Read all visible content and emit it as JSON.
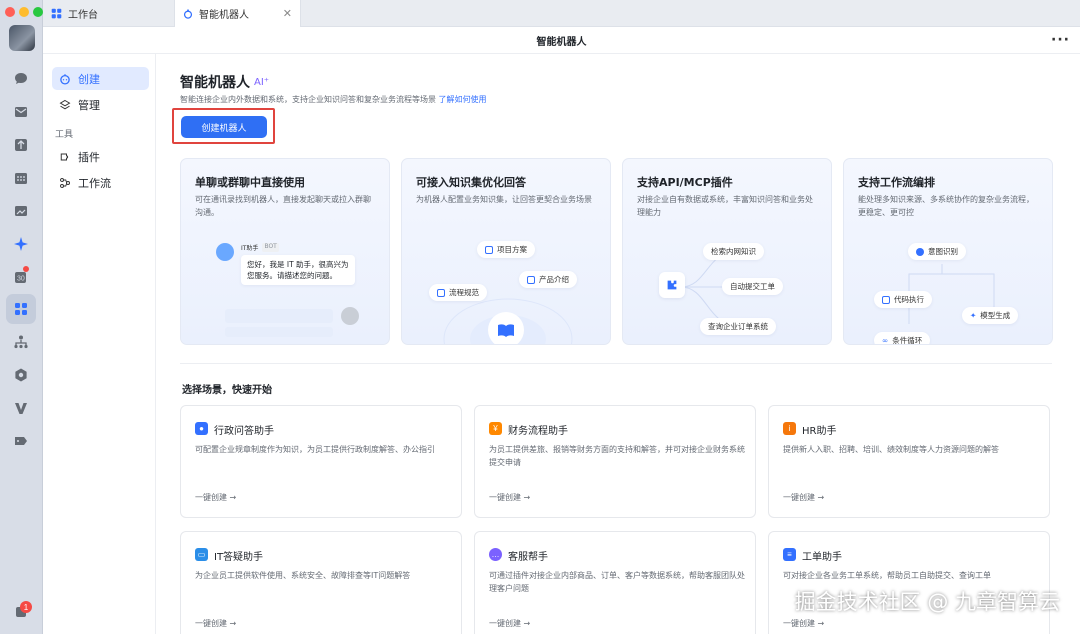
{
  "tabs": [
    {
      "label": "工作台"
    },
    {
      "label": "智能机器人"
    }
  ],
  "window_title": "智能机器人",
  "more_label": "···",
  "sidenav": {
    "create": "创建",
    "manage": "管理",
    "tools_section": "工具",
    "plugins": "插件",
    "workflow": "工作流"
  },
  "header": {
    "title": "智能机器人",
    "ai_tag": "AI⁺",
    "subtitle": "智能连接企业内外数据和系统，支持企业知识问答和复杂业务流程等场景",
    "learn_link": "了解如何使用",
    "create_button": "创建机器人"
  },
  "features": [
    {
      "title": "单聊或群聊中直接使用",
      "desc": "可在通讯录找到机器人，直接发起聊天或拉入群聊沟通。",
      "bot_name": "IT助手",
      "bot_tag": "BOT",
      "bot_message": "您好，我是 IT 助手，很高兴为您服务。请描述您的问题。"
    },
    {
      "title": "可接入知识集优化回答",
      "desc": "为机器人配置业务知识集，让回答更契合业务场景",
      "pills": [
        "项目方案",
        "产品介绍",
        "流程规范"
      ]
    },
    {
      "title": "支持API/MCP插件",
      "desc": "对接企业自有数据或系统，丰富知识问答和业务处理能力",
      "pills": [
        "检索内网知识",
        "自动提交工单",
        "查询企业订单系统"
      ]
    },
    {
      "title": "支持工作流编排",
      "desc": "能处理多知识来源、多系统协作的复杂业务流程，更稳定、更可控",
      "pills": [
        "意图识别",
        "代码执行",
        "模型生成",
        "条件循环"
      ]
    }
  ],
  "quickstart_title": "选择场景，快速开始",
  "cards": [
    {
      "title": "行政问答助手",
      "desc": "可配置企业规章制度作为知识，为员工提供行政制度解答、办公指引",
      "link": "一键创建 →",
      "color": "#3370ff",
      "icon": "person-icon"
    },
    {
      "title": "财务流程助手",
      "desc": "为员工提供差旅、报销等财务方面的支持和解答，并可对接企业财务系统提交申请",
      "link": "一键创建 →",
      "color": "#ff8800",
      "icon": "yen-icon"
    },
    {
      "title": "HR助手",
      "desc": "提供新人入职、招聘、培训、绩效制度等人力资源问题的解答",
      "link": "一键创建 →",
      "color": "#f5770b",
      "icon": "info-icon"
    },
    {
      "title": "IT答疑助手",
      "desc": "为企业员工提供软件使用、系统安全、故障排查等IT问题解答",
      "link": "一键创建 →",
      "color": "#2b8ee8",
      "icon": "monitor-icon"
    },
    {
      "title": "客服帮手",
      "desc": "可通过插件对接企业内部商品、订单、客户等数据系统，帮助客服团队处理客户问题",
      "link": "一键创建 →",
      "color": "#7b61ff",
      "icon": "chat-icon"
    },
    {
      "title": "工单助手",
      "desc": "可对接企业各业务工单系统，帮助员工自助提交、查询工单",
      "link": "一键创建 →",
      "color": "#3370ff",
      "icon": "ticket-icon"
    }
  ],
  "badge_count": "1",
  "watermark": "掘金技术社区 @ 九章智算云"
}
